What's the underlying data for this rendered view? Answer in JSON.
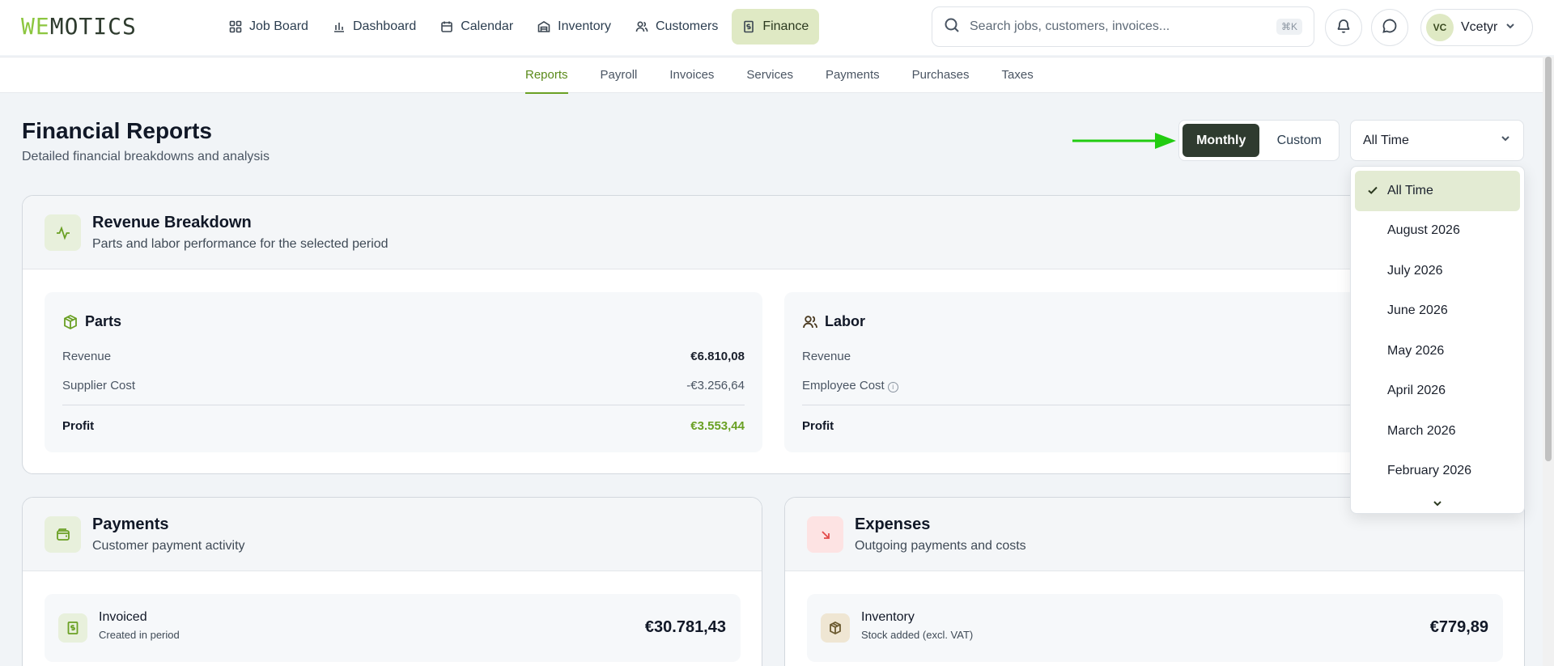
{
  "brand": {
    "logo_we": "WE",
    "logo_rest": "MOTICS"
  },
  "nav": {
    "items": [
      {
        "label": "Job Board",
        "icon": "grid-icon"
      },
      {
        "label": "Dashboard",
        "icon": "bar-chart-icon"
      },
      {
        "label": "Calendar",
        "icon": "calendar-icon"
      },
      {
        "label": "Inventory",
        "icon": "warehouse-icon"
      },
      {
        "label": "Customers",
        "icon": "users-icon"
      },
      {
        "label": "Finance",
        "icon": "receipt-icon",
        "active": true
      }
    ]
  },
  "search": {
    "placeholder": "Search jobs, customers, invoices...",
    "shortcut": "⌘K"
  },
  "user": {
    "initials": "VC",
    "name": "Vcetyr"
  },
  "subnav": {
    "items": [
      "Reports",
      "Payroll",
      "Invoices",
      "Services",
      "Payments",
      "Purchases",
      "Taxes"
    ],
    "active": "Reports"
  },
  "header": {
    "title": "Financial Reports",
    "subtitle": "Detailed financial breakdowns and analysis"
  },
  "period_toggle": {
    "monthly": "Monthly",
    "custom": "Custom",
    "selected": "Monthly"
  },
  "period_select": {
    "value": "All Time",
    "options": [
      "All Time",
      "August 2026",
      "July 2026",
      "June 2026",
      "May 2026",
      "April 2026",
      "March 2026",
      "February 2026"
    ]
  },
  "revenue": {
    "title": "Revenue Breakdown",
    "subtitle": "Parts and labor performance for the selected period",
    "parts": {
      "title": "Parts",
      "revenue_label": "Revenue",
      "revenue": "€6.810,08",
      "cost_label": "Supplier Cost",
      "cost": "-€3.256,64",
      "profit_label": "Profit",
      "profit": "€3.553,44"
    },
    "labor": {
      "title": "Labor",
      "revenue_label": "Revenue",
      "cost_label": "Employee Cost",
      "profit_label": "Profit"
    }
  },
  "payments": {
    "title": "Payments",
    "subtitle": "Customer payment activity",
    "invoiced": {
      "title": "Invoiced",
      "sub": "Created in period",
      "value": "€30.781,43"
    }
  },
  "expenses": {
    "title": "Expenses",
    "subtitle": "Outgoing payments and costs",
    "inventory": {
      "title": "Inventory",
      "sub": "Stock added (excl. VAT)",
      "value": "€779,89"
    }
  },
  "colors": {
    "accent": "#8cc63f",
    "active_nav": "#dfe9c4",
    "dark_toggle": "#2f3b2f",
    "arrow": "#22cc11",
    "expense": "#e24a4a"
  }
}
